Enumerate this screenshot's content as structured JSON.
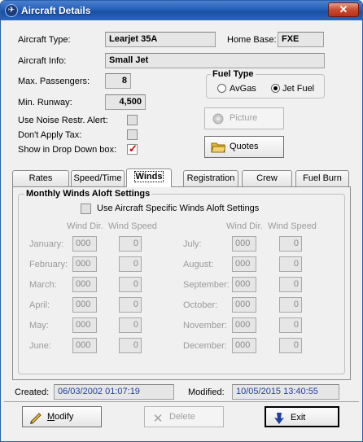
{
  "window": {
    "title": "Aircraft Details",
    "close_label": "✕"
  },
  "fields": {
    "aircraft_type_label": "Aircraft Type:",
    "aircraft_type": "Learjet 35A",
    "home_base_label": "Home Base:",
    "home_base": "FXE",
    "aircraft_info_label": "Aircraft Info:",
    "aircraft_info": "Small Jet",
    "max_passengers_label": "Max. Passengers:",
    "max_passengers": "8",
    "min_runway_label": "Min. Runway:",
    "min_runway": "4,500",
    "noise_alert_label": "Use Noise Restr. Alert:",
    "no_tax_label": "Don't Apply Tax:",
    "show_dropdown_label": "Show in Drop Down box:",
    "noise_alert_checked": false,
    "no_tax_checked": false,
    "show_dropdown_checked": true
  },
  "fuel_type": {
    "title": "Fuel Type",
    "options": [
      "AvGas",
      "Jet Fuel"
    ],
    "selected": "Jet Fuel"
  },
  "buttons": {
    "picture": "Picture",
    "quotes": "Quotes",
    "modify": "Modify",
    "delete": "Delete",
    "exit": "Exit"
  },
  "tabs": [
    "Rates",
    "Speed/Time",
    "Winds",
    "Registration",
    "Crew",
    "Fuel Burn"
  ],
  "active_tab": "Winds",
  "winds": {
    "group_title": "Monthly Winds Aloft Settings",
    "use_specific_label": "Use Aircraft Specific Winds Aloft Settings",
    "use_specific_checked": false,
    "col_wind_dir": "Wind Dir.",
    "col_wind_speed": "Wind Speed",
    "left_months": [
      {
        "month": "January:",
        "dir": "000",
        "speed": "0"
      },
      {
        "month": "February:",
        "dir": "000",
        "speed": "0"
      },
      {
        "month": "March:",
        "dir": "000",
        "speed": "0"
      },
      {
        "month": "April:",
        "dir": "000",
        "speed": "0"
      },
      {
        "month": "May:",
        "dir": "000",
        "speed": "0"
      },
      {
        "month": "June:",
        "dir": "000",
        "speed": "0"
      }
    ],
    "right_months": [
      {
        "month": "July:",
        "dir": "000",
        "speed": "0"
      },
      {
        "month": "August:",
        "dir": "000",
        "speed": "0"
      },
      {
        "month": "September:",
        "dir": "000",
        "speed": "0"
      },
      {
        "month": "October:",
        "dir": "000",
        "speed": "0"
      },
      {
        "month": "November:",
        "dir": "000",
        "speed": "0"
      },
      {
        "month": "December:",
        "dir": "000",
        "speed": "0"
      }
    ]
  },
  "footer": {
    "created_label": "Created:",
    "created": "06/03/2002 01:07:19",
    "modified_label": "Modified:",
    "modified": "10/05/2015 13:40:55"
  }
}
